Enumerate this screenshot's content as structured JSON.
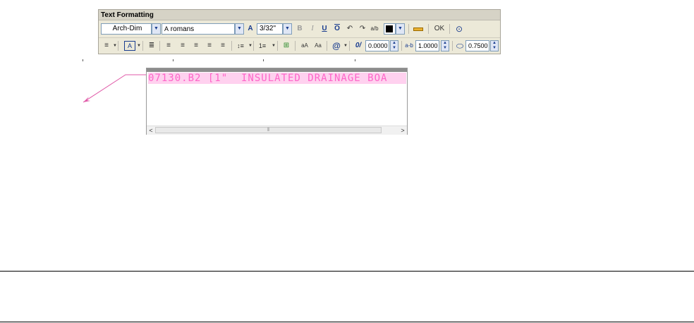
{
  "toolbar": {
    "title": "Text Formatting",
    "style_value": "Arch-Dim",
    "font_value": "romans",
    "font_icon": "A",
    "annotative_icon": "A",
    "height_value": "3/32\"",
    "bold_label": "B",
    "italic_label": "I",
    "underline_label": "U",
    "overline_label": "O",
    "undo_icon": "↶",
    "redo_icon": "↷",
    "stack_icon": "a/b",
    "color_value": "■",
    "ok_label": "OK",
    "options_icon": "⊙"
  },
  "toolbar2": {
    "columns_icon": "≡",
    "mtext_justify_icon": "A",
    "paragraph_icon": "≣",
    "align_left_icon": "≡",
    "align_center_icon": "≡",
    "align_right_icon": "≡",
    "justify_icon": "≡",
    "distribute_icon": "≡",
    "line_spacing_icon": "↕≡",
    "numbering_icon": "1≡",
    "insert_field_icon": "⊞",
    "uppercase_label": "aA",
    "lowercase_label": "Aa",
    "symbol_icon": "@",
    "oblique_icon": "0/",
    "oblique_value": "0.0000",
    "tracking_icon": "a-b",
    "tracking_value": "1.0000",
    "width_icon": "⬭",
    "width_value": "0.7500"
  },
  "editor": {
    "text": "07130.B2 [1\"  INSULATED DRAINAGE BOA",
    "scroll_grip": "⦀"
  },
  "colors": {
    "text_color": "#ff64c8",
    "highlight": "#ffd1ef",
    "leader": "#e05aa8"
  }
}
